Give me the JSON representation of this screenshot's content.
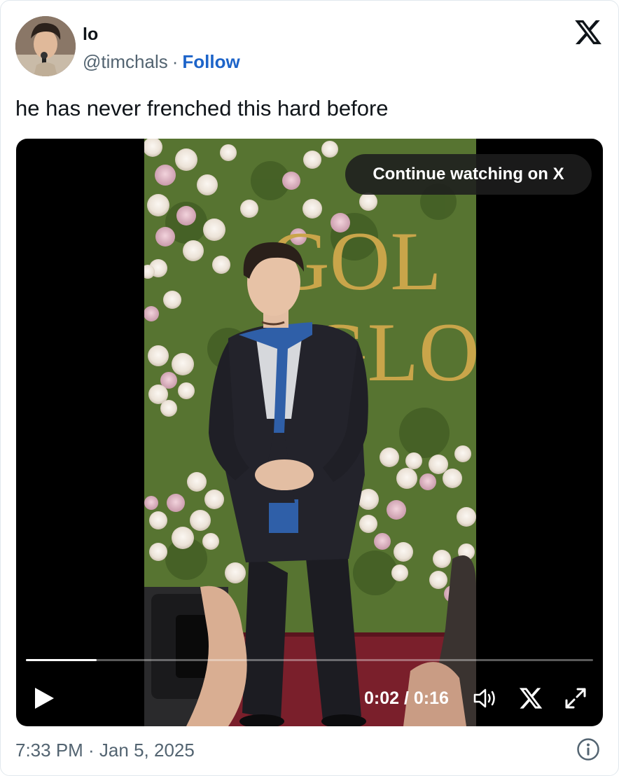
{
  "author": {
    "name": "lo",
    "handle": "@timchals",
    "separator": "·",
    "follow_label": "Follow"
  },
  "tweet": {
    "text": "he has never frenched this hard before"
  },
  "video": {
    "continue_label": "Continue watching on X",
    "time_display": "0:02 / 0:16",
    "progress_fraction": 0.125,
    "backdrop_text": [
      "GOL",
      "GLO"
    ]
  },
  "footer": {
    "timestamp": "7:33 PM · Jan 5, 2025"
  },
  "icons": {
    "brand": "x-logo-icon",
    "play": "play-icon",
    "volume": "volume-icon",
    "fullscreen": "fullscreen-icon",
    "info": "info-icon"
  },
  "colors": {
    "follow": "#1d64c9",
    "secondary_text": "#536471",
    "primary_text": "#0f1419",
    "video_bg": "#000000"
  }
}
